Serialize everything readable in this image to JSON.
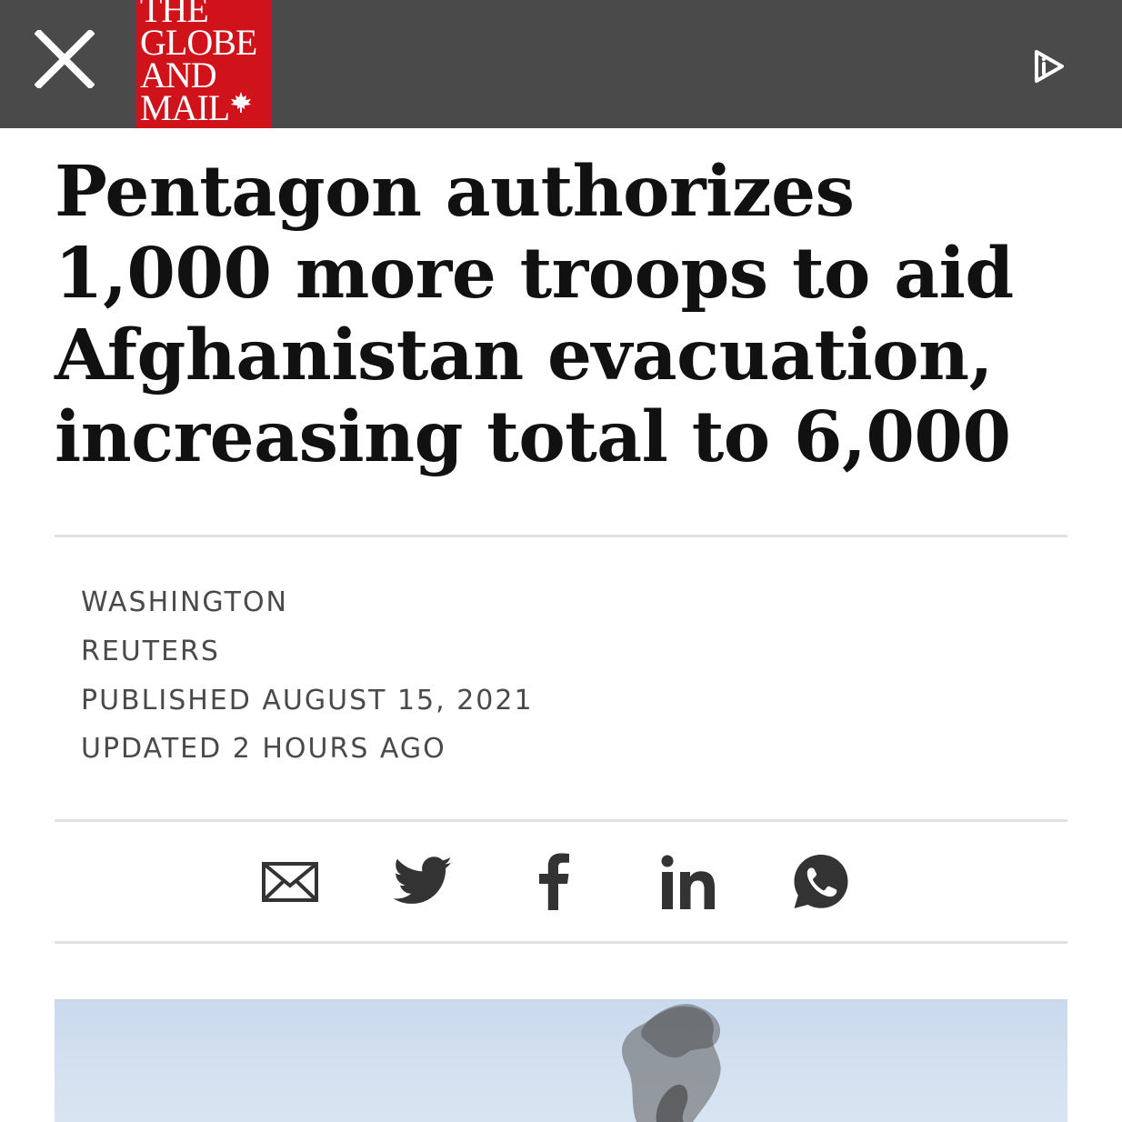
{
  "logo": {
    "lines": [
      "THE",
      "GLOBE",
      "AND",
      "MAIL"
    ]
  },
  "icons": {
    "close": "close-icon",
    "ar": "ar-play-icon",
    "share": [
      "email-icon",
      "twitter-icon",
      "facebook-icon",
      "linkedin-icon",
      "whatsapp-icon"
    ]
  },
  "colors": {
    "brand_red": "#d0131b",
    "topbar": "#4a4a4a"
  },
  "article": {
    "headline": "Pentagon authorizes 1,000 more troops to aid Afghanistan evacuation, increasing total to 6,000",
    "dateline": "WASHINGTON",
    "source": "REUTERS",
    "published": "PUBLISHED AUGUST 15, 2021",
    "updated": "UPDATED 2 HOURS AGO"
  }
}
